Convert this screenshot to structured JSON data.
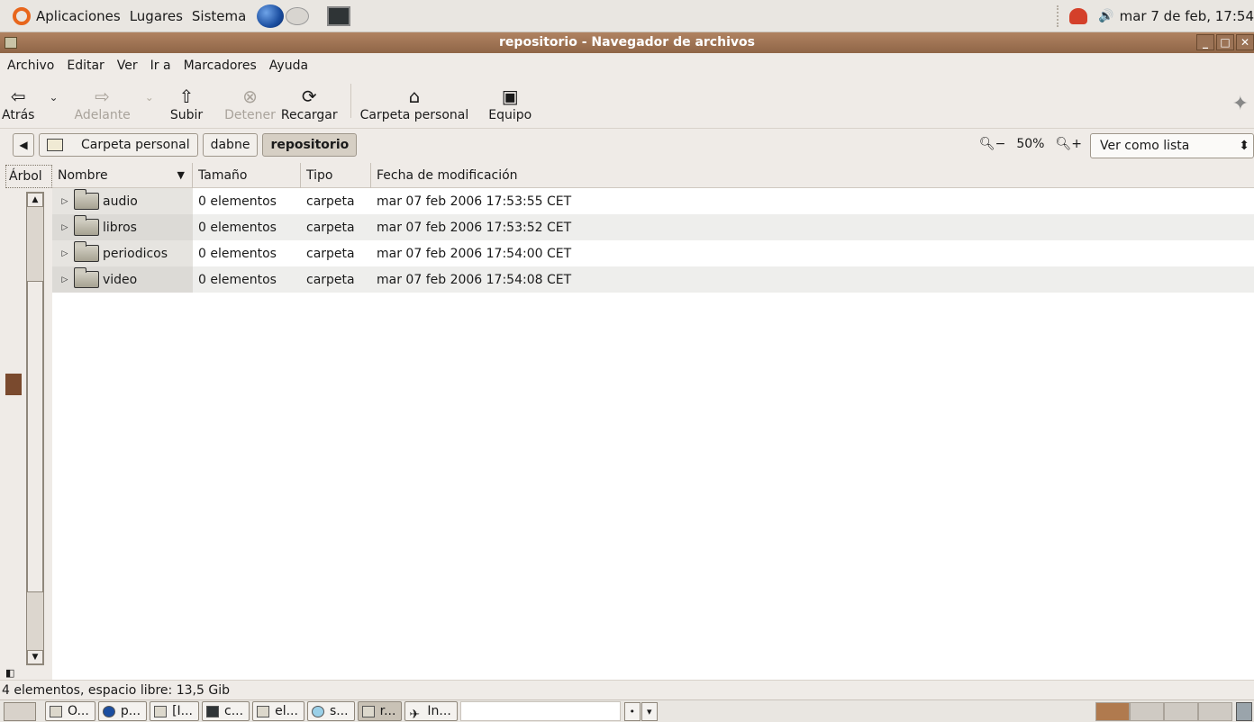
{
  "top_panel": {
    "menus": [
      "Aplicaciones",
      "Lugares",
      "Sistema"
    ],
    "clock": "mar  7 de feb, 17:54",
    "volume_glyph": "🔊"
  },
  "window": {
    "title": "repositorio - Navegador de archivos"
  },
  "menubar": [
    "Archivo",
    "Editar",
    "Ver",
    "Ir a",
    "Marcadores",
    "Ayuda"
  ],
  "toolbar": {
    "back": "Atrás",
    "forward": "Adelante",
    "up": "Subir",
    "stop": "Detener",
    "reload": "Recargar",
    "home": "Carpeta personal",
    "computer": "Equipo"
  },
  "location": {
    "crumbs": [
      "Carpeta personal",
      "dabne",
      "repositorio"
    ],
    "zoom": "50%",
    "view_mode": "Ver como lista"
  },
  "sidebar": {
    "title": "Árbol"
  },
  "list": {
    "columns": [
      "Nombre",
      "Tamaño",
      "Tipo",
      "Fecha de modificación"
    ],
    "rows": [
      {
        "name": "audio",
        "size": "0 elementos",
        "type": "carpeta",
        "date": "mar 07 feb 2006 17:53:55 CET"
      },
      {
        "name": "libros",
        "size": "0 elementos",
        "type": "carpeta",
        "date": "mar 07 feb 2006 17:53:52 CET"
      },
      {
        "name": "periodicos",
        "size": "0 elementos",
        "type": "carpeta",
        "date": "mar 07 feb 2006 17:54:00 CET"
      },
      {
        "name": "video",
        "size": "0 elementos",
        "type": "carpeta",
        "date": "mar 07 feb 2006 17:54:08 CET"
      }
    ]
  },
  "status": "4 elementos, espacio libre: 13,5 Gib",
  "taskbar": {
    "tasks": [
      "O...",
      "p...",
      "[I...",
      "c...",
      "el...",
      "s...",
      "r...",
      "In..."
    ]
  }
}
